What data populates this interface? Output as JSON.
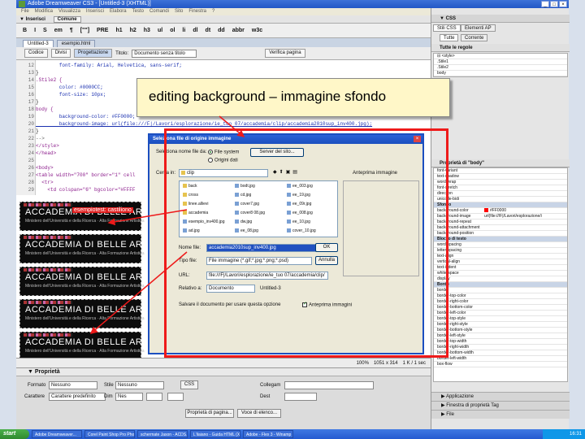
{
  "window": {
    "title": "Adobe Dreamweaver CS3 - [Untitled-3 (XHTML)]",
    "controls": [
      "_",
      "□",
      "×"
    ]
  },
  "menu": [
    "File",
    "Modifica",
    "Visualizza",
    "Inserisci",
    "Elabora",
    "Testo",
    "Comandi",
    "Sito",
    "Finestra",
    "?"
  ],
  "insert_bar": {
    "label": "▼ Inserisci",
    "tab": "Comune"
  },
  "format_bar": [
    "B",
    "I",
    "S",
    "em",
    "¶",
    "[\"\"]",
    "PRE",
    "h1",
    "h2",
    "h3",
    "ul",
    "ol",
    "li",
    "dl",
    "dt",
    "dd",
    "abbr",
    "w3c"
  ],
  "doc_tabs": [
    "Untitled-3",
    "esempio.html"
  ],
  "doc_toolbar": {
    "buttons": [
      "Codice",
      "Divisi",
      "Progettazione"
    ],
    "active": "Progettazione",
    "title_label": "Titolo:",
    "title_value": "Documento senza titolo",
    "validate": "Verifica pagina"
  },
  "code_lines": [
    {
      "n": "12",
      "t": "        font-family: Arial, Helvetica, sans-serif;",
      "c": "c-blue"
    },
    {
      "n": "13",
      "t": "}",
      "c": ""
    },
    {
      "n": "14",
      "t": ".Stile2 {",
      "c": "c-purple"
    },
    {
      "n": "15",
      "t": "        color: #0000CC;",
      "c": "c-blue"
    },
    {
      "n": "16",
      "t": "        font-size: 10px;",
      "c": "c-blue"
    },
    {
      "n": "17",
      "t": "}",
      "c": ""
    },
    {
      "n": "18",
      "t": "body {",
      "c": "c-purple"
    },
    {
      "n": "19",
      "t": "        background-color: #FF0000;",
      "c": "c-blue"
    },
    {
      "n": "20",
      "t": "        background-image: url(file:///F|/Lavori/esplorazione/ie_tuo 07/accademia/clip/accademia2010sup_inv400.jpg);",
      "c": "c-sel"
    },
    {
      "n": "21",
      "t": "}",
      "c": ""
    },
    {
      "n": "22",
      "t": "-->",
      "c": "c-gray"
    },
    {
      "n": "23",
      "t": "</style>",
      "c": "c-purple"
    },
    {
      "n": "24",
      "t": "</head>",
      "c": "c-purple"
    },
    {
      "n": "25",
      "t": "",
      "c": ""
    },
    {
      "n": "26",
      "t": "<body>",
      "c": "c-purple"
    },
    {
      "n": "27",
      "t": "<table width=\"700\" border=\"1\" cell",
      "c": "c-purple"
    },
    {
      "n": "28",
      "t": "  <tr>",
      "c": "c-purple"
    },
    {
      "n": "29",
      "t": "    <td colspan=\"6\" bgcolor=\"#FFFF",
      "c": "c-purple"
    }
  ],
  "design_rows": [
    {
      "title": "ACCADEMIA DI BELLE ARTI PALERMO",
      "sub": "Ministero dell'Università e della Ricerca · Alta Formazione Artistica",
      "highlight": "esempiotest: castiliono"
    },
    {
      "title": "ACCADEMIA DI BELLE ARTI PALERMO",
      "sub": "Ministero dell'Università e della Ricerca · Alta Formazione Artistica",
      "highlight": ""
    },
    {
      "title": "ACCADEMIA DI BELLE ARTI PALERMO",
      "sub": "Ministero dell'Università e della Ricerca · Alta Formazione Artistica",
      "highlight": ""
    },
    {
      "title": "ACCADEMIA DI BELLE ARTI PALERMO",
      "sub": "Ministero dell'Università e della Ricerca · Alta Formazione Artistica",
      "highlight": ""
    },
    {
      "title": "ACCADEMIA DI BELLE ARTI PALERMO",
      "sub": "Ministero dell'Università e della Ricerca · Alta Formazione Artistica",
      "highlight": ""
    }
  ],
  "status": {
    "zoom": "100%",
    "size": "1051 x 314",
    "weight": "1 K / 1 sec"
  },
  "properties": {
    "header": "▼ Proprietà",
    "format_label": "Formato",
    "format_value": "Nessuno",
    "style_label": "Stile",
    "style_value": "Nessuno",
    "css_btn": "CSS",
    "link_label": "Collegam",
    "font_label": "Carattere",
    "font_value": "Carattere predefinito",
    "size_label": "Dim",
    "size_value": "Nes",
    "dest_label": "Dest",
    "page_props_btn": "Proprietà di pagina...",
    "list_btn": "Voce di elenco..."
  },
  "callout": {
    "text": "editing background – immagine sfondo"
  },
  "dialog": {
    "title": "Seleziona file di origine immagine",
    "select_label": "Seleziona nome file da:",
    "radio_fs": "File system",
    "radio_ds": "Origini dati",
    "site_btn": "Server del sito...",
    "look_in_label": "Cerca in:",
    "look_in_value": "clip",
    "preview_label": "Anteprima immagine",
    "files": [
      "back",
      "cross",
      "linee.allievi",
      "accademia",
      "esempio_inv400.jpg",
      "ad.jpg",
      "bodt.jpg",
      "cd.jpg",
      "cover7.jpg",
      "cover8 08.jpg",
      "dw.jpg",
      "ee_08.jpg",
      "ee_003.jpg",
      "ee_19.jpg",
      "ee_09r.jpg",
      "ee_008.jpg",
      "ee_10.jpg",
      "cover_10.jpg"
    ],
    "filename_label": "Nome file:",
    "filename_value": "accademia2010sup_inv400.jpg",
    "ok_btn": "OK",
    "filetype_label": "Tipo file:",
    "filetype_value": "File immagine (*.gif;*.jpg;*.png;*.psd)",
    "cancel_btn": "Annulla",
    "url_label": "URL:",
    "url_value": "file:///F|/Lavori/esplorazione/ie_tuo 07/accademia/clip/",
    "relative_label": "Relativo a:",
    "relative_value": "Documento",
    "relative_doc": "Untitled-3",
    "note": "Salvare il documento per usare questa opzione",
    "preview_check": "Anteprima immagini"
  },
  "right_panel": {
    "css_header": "▼ CSS",
    "tabs": [
      "Stili CSS",
      "Elementi AP"
    ],
    "modes": [
      "Tutte",
      "Corrente"
    ],
    "rules_header": "Tutte le regole",
    "rules": [
      "⊟ <style>",
      "   .Stile1",
      "   .Stile2",
      "   body"
    ],
    "props_header": "Proprietà di \"body\"",
    "props": [
      {
        "name": "font-variant",
        "val": "",
        "sec": false
      },
      {
        "name": "text-shadow",
        "val": "",
        "sec": false
      },
      {
        "name": "word-wrap",
        "val": "",
        "sec": false
      },
      {
        "name": "font-stretch",
        "val": "",
        "sec": false
      },
      {
        "name": "direction",
        "val": "",
        "sec": false
      },
      {
        "name": "unicode-bidi",
        "val": "",
        "sec": false
      },
      {
        "name": "Sfondo",
        "val": "",
        "sec": true
      },
      {
        "name": "background-color",
        "val": "#FF0000",
        "sec": false,
        "swatch": "#FF0000"
      },
      {
        "name": "background-image",
        "val": "url(file:///F|/Lavori/esplorazione/i",
        "sec": false
      },
      {
        "name": "background-repeat",
        "val": "",
        "sec": false
      },
      {
        "name": "background-attachment",
        "val": "",
        "sec": false
      },
      {
        "name": "background-position",
        "val": "",
        "sec": false
      },
      {
        "name": "Blocco di testo",
        "val": "",
        "sec": true
      },
      {
        "name": "word-spacing",
        "val": "",
        "sec": false
      },
      {
        "name": "letter-spacing",
        "val": "",
        "sec": false
      },
      {
        "name": "text-align",
        "val": "",
        "sec": false
      },
      {
        "name": "vertical-align",
        "val": "",
        "sec": false
      },
      {
        "name": "text-indent",
        "val": "",
        "sec": false
      },
      {
        "name": "white-space",
        "val": "",
        "sec": false
      },
      {
        "name": "display",
        "val": "",
        "sec": false
      },
      {
        "name": "Bordo",
        "val": "",
        "sec": true
      },
      {
        "name": "border",
        "val": "",
        "sec": false
      },
      {
        "name": "border-top-color",
        "val": "",
        "sec": false
      },
      {
        "name": "border-right-color",
        "val": "",
        "sec": false
      },
      {
        "name": "border-bottom-color",
        "val": "",
        "sec": false
      },
      {
        "name": "border-left-color",
        "val": "",
        "sec": false
      },
      {
        "name": "border-top-style",
        "val": "",
        "sec": false
      },
      {
        "name": "border-right-style",
        "val": "",
        "sec": false
      },
      {
        "name": "border-bottom-style",
        "val": "",
        "sec": false
      },
      {
        "name": "border-left-style",
        "val": "",
        "sec": false
      },
      {
        "name": "border-top-width",
        "val": "",
        "sec": false
      },
      {
        "name": "border-right-width",
        "val": "",
        "sec": false
      },
      {
        "name": "border-bottom-width",
        "val": "",
        "sec": false
      },
      {
        "name": "border-left-width",
        "val": "",
        "sec": false
      },
      {
        "name": "box-flow",
        "val": "",
        "sec": false
      }
    ],
    "groups": [
      "▶ Applicazione",
      "▶ Finestra di proprietà Tag",
      "▶ File"
    ]
  },
  "taskbar": {
    "start": "start",
    "items": [
      "Adobe Dreamweaver...",
      "Corel Paint Shop Pro Pho...",
      "schermate Jason - ACDS...",
      "L'ilaiano - Guida HTML (X...",
      "Adobe - Flex 3 - Winamp"
    ],
    "clock": "16:31"
  },
  "colors": {
    "annotation_border": "#ee1a1a",
    "callout_bg": "#fff7c8",
    "titlebar": "#2257c6"
  }
}
